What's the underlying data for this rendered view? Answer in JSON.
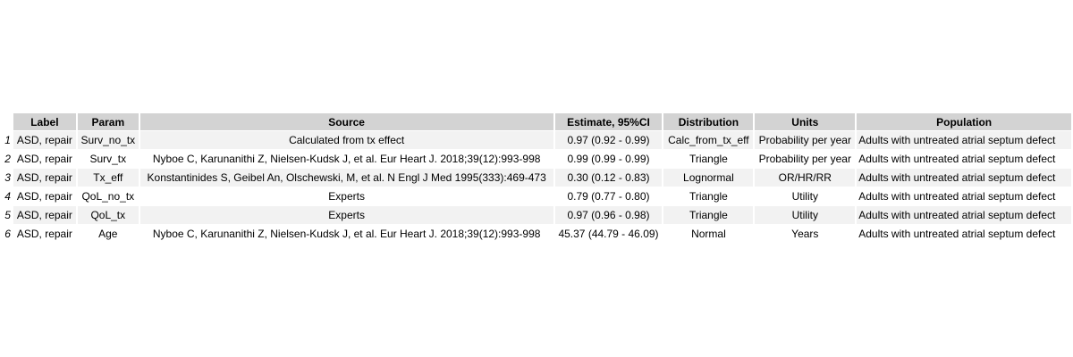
{
  "table": {
    "headers": [
      "Label",
      "Param",
      "Source",
      "Estimate, 95%CI",
      "Distribution",
      "Units",
      "Population"
    ],
    "rows": [
      {
        "n": "1",
        "label": "ASD, repair",
        "param": "Surv_no_tx",
        "source": "Calculated from tx effect",
        "estimate": "0.97 (0.92 - 0.99)",
        "distribution": "Calc_from_tx_eff",
        "units": "Probability per year",
        "population": "Adults with untreated atrial septum defect"
      },
      {
        "n": "2",
        "label": "ASD, repair",
        "param": "Surv_tx",
        "source": "Nyboe C, Karunanithi Z, Nielsen-Kudsk J, et al. Eur Heart J. 2018;39(12):993-998",
        "estimate": "0.99 (0.99 - 0.99)",
        "distribution": "Triangle",
        "units": "Probability per year",
        "population": "Adults with untreated atrial septum defect"
      },
      {
        "n": "3",
        "label": "ASD, repair",
        "param": "Tx_eff",
        "source": "Konstantinides S, Geibel An, Olschewski, M, et al. N Engl J Med 1995(333):469-473",
        "estimate": "0.30 (0.12 - 0.83)",
        "distribution": "Lognormal",
        "units": "OR/HR/RR",
        "population": "Adults with untreated atrial septum defect"
      },
      {
        "n": "4",
        "label": "ASD, repair",
        "param": "QoL_no_tx",
        "source": "Experts",
        "estimate": "0.79 (0.77 - 0.80)",
        "distribution": "Triangle",
        "units": "Utility",
        "population": "Adults with untreated atrial septum defect"
      },
      {
        "n": "5",
        "label": "ASD, repair",
        "param": "QoL_tx",
        "source": "Experts",
        "estimate": "0.97 (0.96 - 0.98)",
        "distribution": "Triangle",
        "units": "Utility",
        "population": "Adults with untreated atrial septum defect"
      },
      {
        "n": "6",
        "label": "ASD, repair",
        "param": "Age",
        "source": "Nyboe C, Karunanithi Z, Nielsen-Kudsk J, et al. Eur Heart J. 2018;39(12):993-998",
        "estimate": "45.37 (44.79 - 46.09)",
        "distribution": "Normal",
        "units": "Years",
        "population": "Adults with untreated atrial septum defect"
      }
    ]
  }
}
